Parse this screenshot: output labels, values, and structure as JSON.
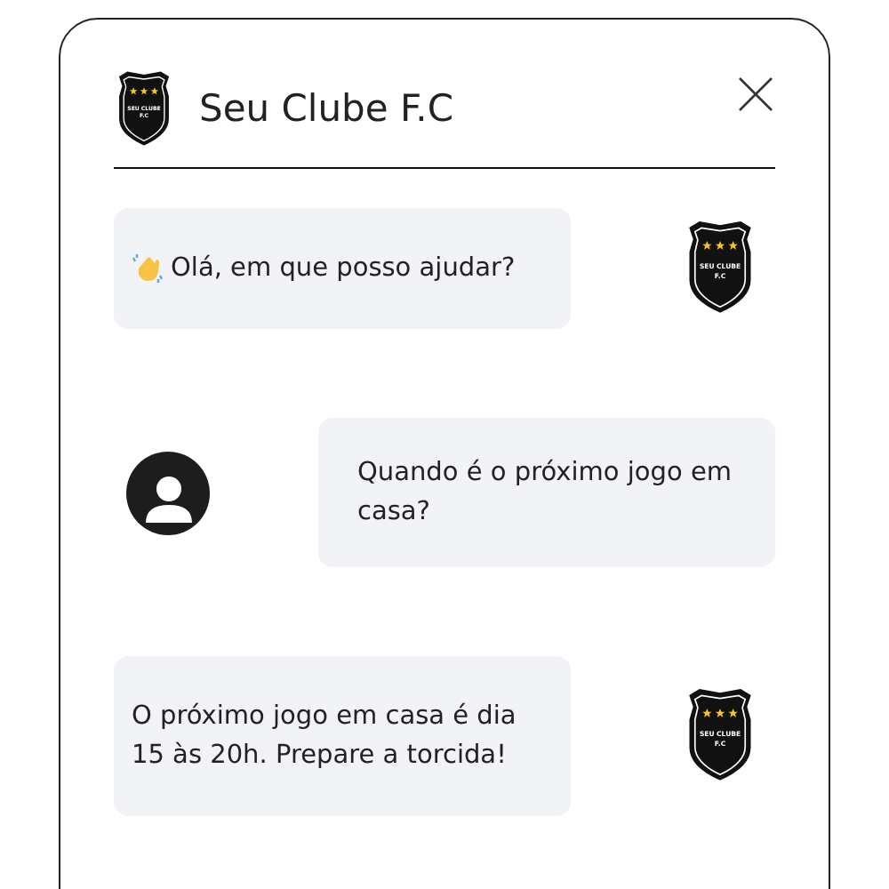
{
  "header": {
    "title": "Seu Clube F.C",
    "logo_text": [
      "SEU CLUBE",
      "F.C"
    ]
  },
  "messages": [
    {
      "kind": "bot",
      "text": "Olá, em que posso ajudar?",
      "emoji": true,
      "logo_text": [
        "SEU CLUBE",
        "F.C"
      ]
    },
    {
      "kind": "user",
      "text": "Quando é o próximo jogo em casa?"
    },
    {
      "kind": "bot",
      "text": "O próximo jogo em casa é dia 15 às 20h. Prepare a torcida!",
      "emoji": false,
      "logo_text": [
        "SEU CLUBE",
        "F.C"
      ]
    }
  ]
}
